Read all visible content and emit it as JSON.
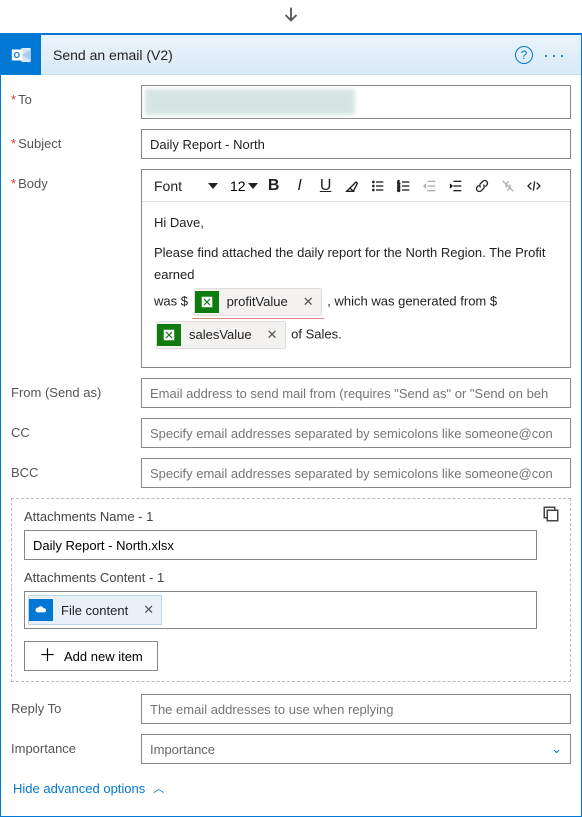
{
  "header": {
    "title": "Send an email (V2)"
  },
  "fields": {
    "to_label": "To",
    "subject_label": "Subject",
    "subject_value": "Daily Report - North",
    "body_label": "Body",
    "from_label": "From (Send as)",
    "from_placeholder": "Email address to send mail from (requires \"Send as\" or \"Send on beh",
    "cc_label": "CC",
    "cc_placeholder": "Specify email addresses separated by semicolons like someone@con",
    "bcc_label": "BCC",
    "bcc_placeholder": "Specify email addresses separated by semicolons like someone@con",
    "reply_label": "Reply To",
    "reply_placeholder": "The email addresses to use when replying",
    "importance_label": "Importance",
    "importance_placeholder": "Importance"
  },
  "editor": {
    "font_label": "Font",
    "size": "12",
    "body": {
      "greet": "Hi Dave,",
      "l1a": "Please find attached the daily report for the North Region.  The Profit earned",
      "l1b": "was $ ",
      "l1c": " , which was generated from $",
      "l2b": " of Sales.",
      "tag_profit": "profitValue",
      "tag_sales": "salesValue"
    }
  },
  "attachments": {
    "name_label": "Attachments Name - 1",
    "name_value": "Daily Report - North.xlsx",
    "content_label": "Attachments Content - 1",
    "content_tag": "File content",
    "add_label": "Add new item"
  },
  "footer": {
    "hide": "Hide advanced options"
  }
}
